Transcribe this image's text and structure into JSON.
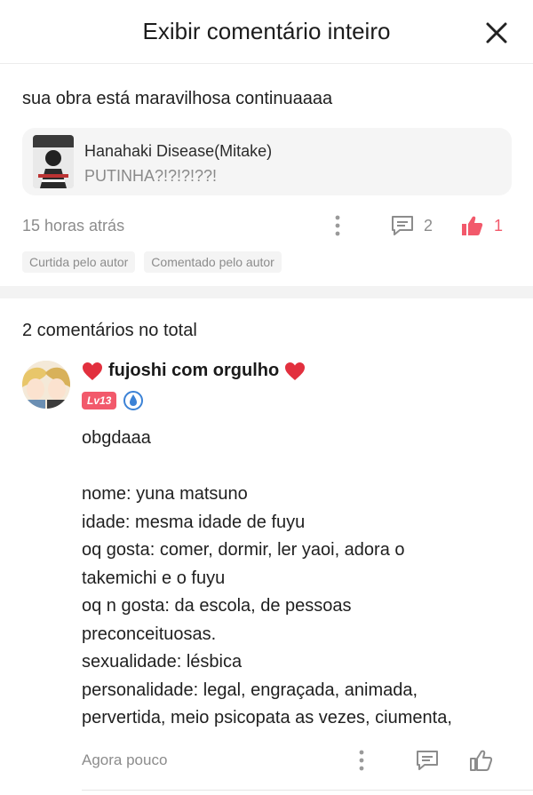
{
  "header": {
    "title": "Exibir comentário inteiro"
  },
  "main_comment": {
    "text": "sua obra está maravilhosa continuaaaa",
    "reference": {
      "title": "Hanahaki Disease(Mitake)",
      "subtitle": "PUTINHA?!?!?!??!"
    },
    "time": "15 horas atrás",
    "reply_count": "2",
    "like_count": "1",
    "tags": [
      "Curtida pelo autor",
      "Comentado pelo autor"
    ]
  },
  "replies_section": {
    "total_label": "2 comentários no total"
  },
  "reply": {
    "username": "fujoshi com orgulho",
    "level": "Lv13",
    "lines": [
      "obgdaaa",
      "",
      "nome: yuna matsuno",
      "idade: mesma idade de fuyu",
      "oq gosta: comer, dormir, ler yaoi, adora o",
      "takemichi e o fuyu",
      "oq n gosta: da escola, de pessoas",
      "preconceituosas.",
      "sexualidade: lésbica",
      "personalidade: legal, engraçada, animada,",
      "pervertida, meio psicopata as vezes, ciumenta,"
    ],
    "time": "Agora pouco"
  },
  "colors": {
    "accent": "#f2596b",
    "muted": "#8c8c8c",
    "divider": "#f3f3f3"
  },
  "icons": [
    "close-icon",
    "more-dots-icon",
    "comment-icon",
    "thumbs-up-icon",
    "heart-icon",
    "droplet-badge-icon"
  ]
}
